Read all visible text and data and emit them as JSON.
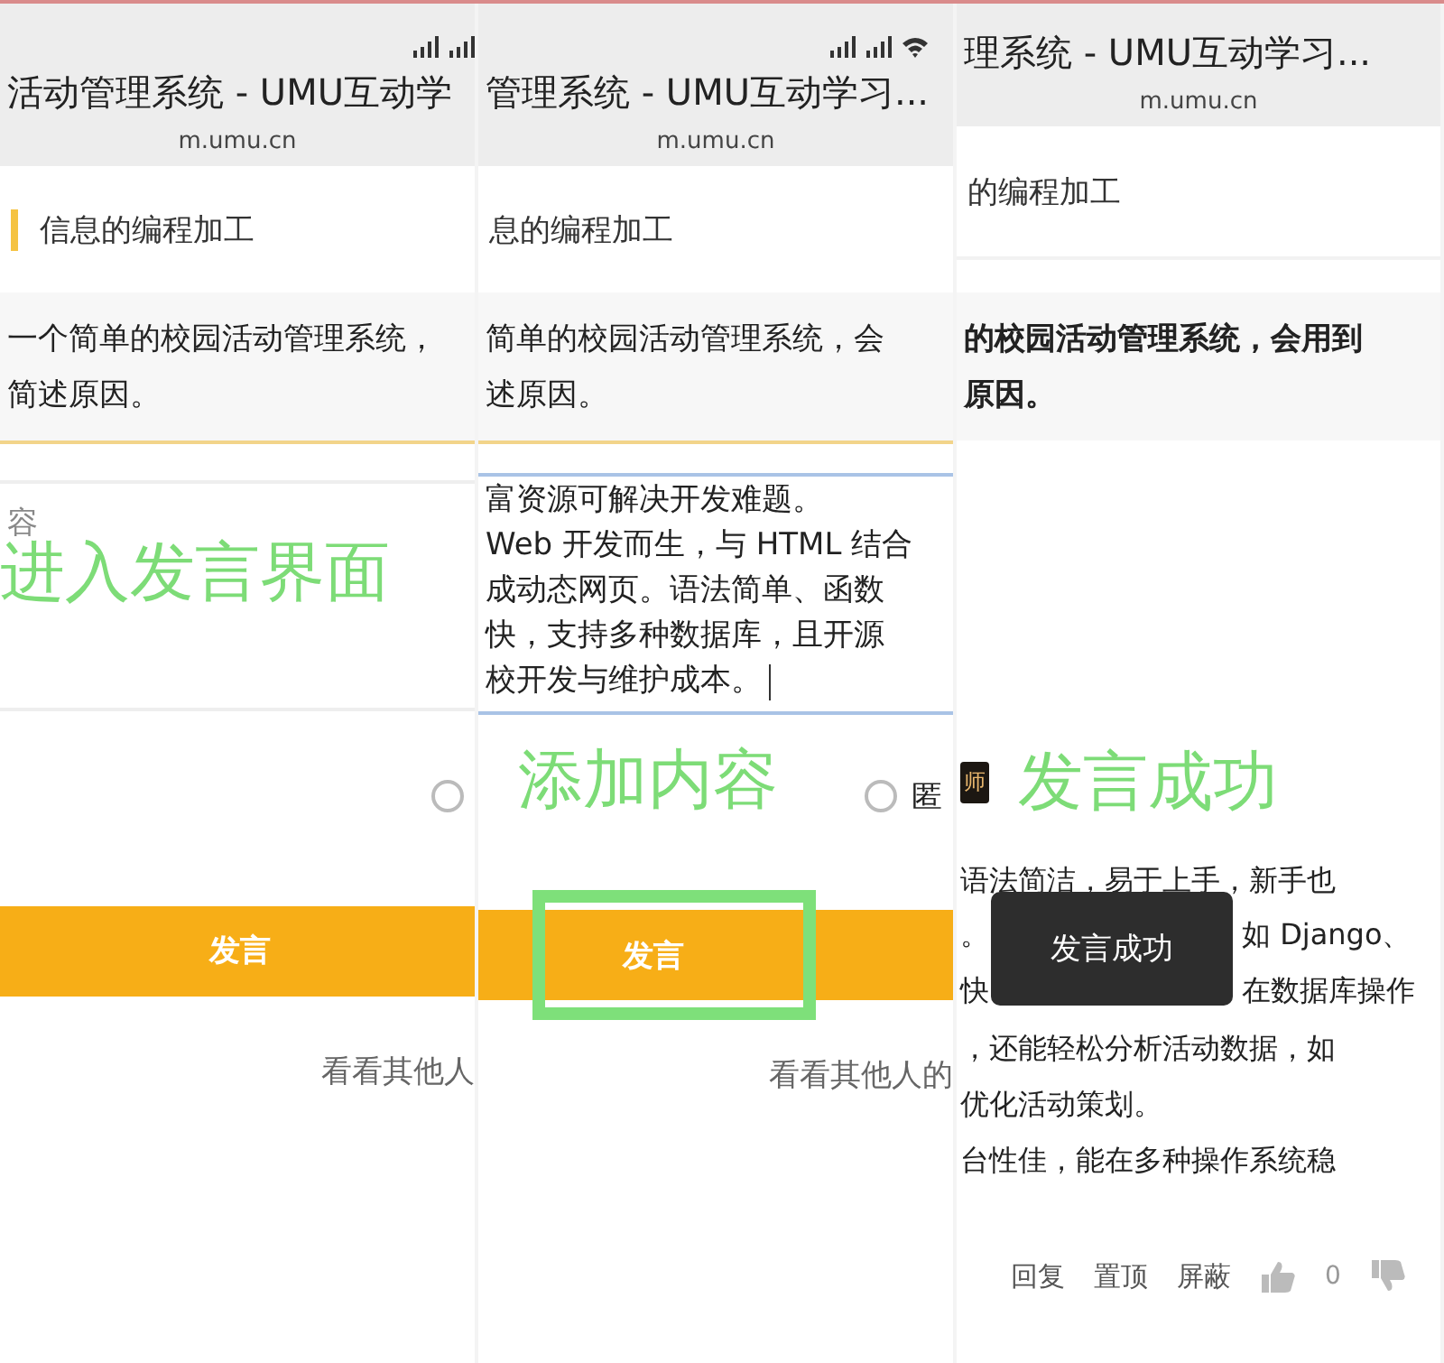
{
  "screens": [
    {
      "kind": "compose",
      "title": "活动管理系统 - UMU互动学",
      "url": "m.umu.cn",
      "section": "信息的编程加工",
      "section_marker": true,
      "question": [
        "一个简单的校园活动管理系统，",
        "简述原因。"
      ],
      "question_bold": false,
      "input": {
        "placeholder": "容",
        "focused": false,
        "annotation": "进入发言界面"
      },
      "anonymous": {
        "checked": false
      },
      "submit": {
        "label": "发言",
        "highlighted": false
      },
      "others_link": "看看其他人"
    },
    {
      "kind": "compose",
      "title": "管理系统 - UMU互动学习...",
      "url": "m.umu.cn",
      "section": "息的编程加工",
      "section_marker": false,
      "question": [
        "简单的校园活动管理系统，会",
        "述原因。"
      ],
      "question_bold": false,
      "input": {
        "lines": [
          "富资源可解决开发难题。",
          "Web 开发而生，与 HTML 结合",
          "成动态网页。语法简单、函数",
          "快，支持多种数据库，且开源",
          "校开发与维护成本。"
        ],
        "cursor": true,
        "focused": true
      },
      "anonymous": {
        "checked": false,
        "label": "匿",
        "annotation": "添加内容"
      },
      "submit": {
        "label": "发言",
        "highlighted": true
      },
      "others_link": "看看其他人的"
    },
    {
      "kind": "posted",
      "title": "理系统 - UMU互动学习...",
      "url": "m.umu.cn",
      "section": "的编程加工",
      "section_marker": false,
      "question": [
        "的校园活动管理系统，会用到",
        "原因。"
      ],
      "question_bold": true,
      "comment": {
        "badge": "师",
        "annotation": "发言成功",
        "lines": [
          {
            "kind": "full",
            "text": "语法简洁，易于上手，新手也"
          },
          {
            "kind": "split",
            "left": "。",
            "right": "如 Django、"
          },
          {
            "kind": "split",
            "left": "快",
            "right": "在数据库操作"
          },
          {
            "kind": "full",
            "text": "，还能轻松分析活动数据，如"
          },
          {
            "kind": "full",
            "text": "优化活动策划。"
          },
          {
            "kind": "full",
            "text": "台性佳，能在多种操作系统稳"
          }
        ],
        "actions": [
          "回复",
          "置顶",
          "屏蔽"
        ],
        "likes": "0"
      },
      "toast": "发言成功"
    }
  ]
}
